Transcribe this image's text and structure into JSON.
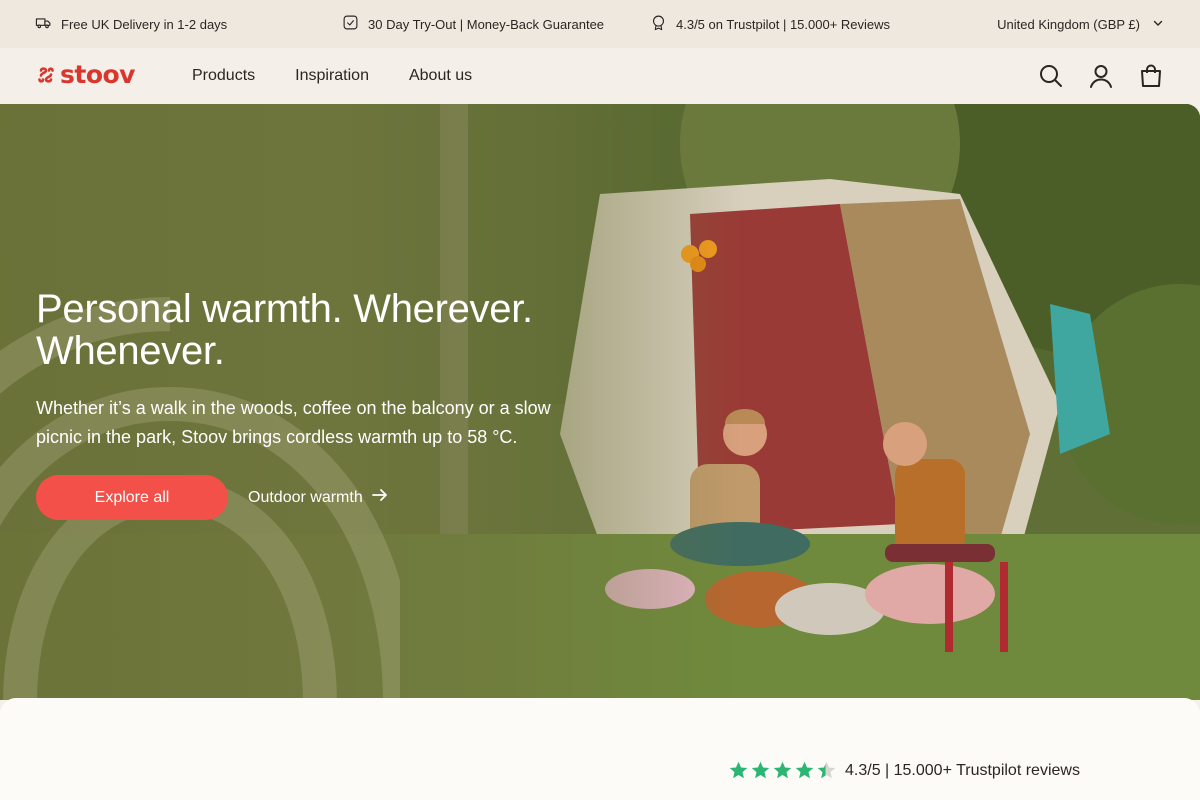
{
  "topbar": {
    "usps": [
      {
        "icon": "truck-icon",
        "text": "Free UK Delivery in 1-2 days"
      },
      {
        "icon": "checkbox-icon",
        "text": "30 Day Try-Out | Money-Back Guarantee"
      },
      {
        "icon": "rating-badge-icon",
        "text": "4.3/5 on Trustpilot | 15.000+ Reviews"
      }
    ],
    "region": "United Kingdom (GBP £)"
  },
  "header": {
    "logo": "stoov",
    "nav": [
      "Products",
      "Inspiration",
      "About us"
    ],
    "icons": [
      "search-icon",
      "account-icon",
      "bag-icon"
    ]
  },
  "hero": {
    "title": "Personal warmth. Wherever. Whenever.",
    "text": "Whether it’s a walk in the woods, coffee on the balcony or a slow picnic in the park, Stoov brings cordless warmth up to 58 °C.",
    "primary_button": "Explore all",
    "secondary_link": "Outdoor warmth"
  },
  "trustpilot": {
    "rating": 4.3,
    "max": 5,
    "text": "4.3/5 | 15.000+ Trustpilot reviews"
  },
  "colors": {
    "brand": "#d9362e",
    "button": "#f25048",
    "star": "#2bb673",
    "hero_overlay": "#6b7239"
  }
}
